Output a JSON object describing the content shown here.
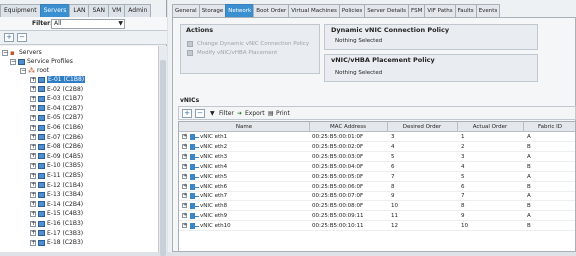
{
  "left_nav": {
    "tabs": [
      "Equipment",
      "Servers",
      "LAN",
      "SAN",
      "VM",
      "Admin"
    ],
    "active_tab": "Servers",
    "filter_label": "Filter:",
    "filter_value": "All",
    "add_icon": "+",
    "remove_icon": "−",
    "tree": {
      "servers": "Servers",
      "service_profiles": "Service Profiles",
      "root": "root",
      "profiles": [
        "E-01 (C1B8)",
        "E-02 (C2B8)",
        "E-03 (C1B7)",
        "E-04 (C2B7)",
        "E-05 (C2B7)",
        "E-06 (C1B6)",
        "E-07 (C2B6)",
        "E-08 (C2B6)",
        "E-09 (C4B5)",
        "E-10 (C3B5)",
        "E-11 (C2B5)",
        "E-12 (C1B4)",
        "E-13 (C3B4)",
        "E-14 (C2B4)",
        "E-15 (C4B3)",
        "E-16 (C1B3)",
        "E-17 (C3B3)",
        "E-18 (C2B3)"
      ],
      "selected_index": 0
    }
  },
  "right": {
    "tabs": [
      "General",
      "Storage",
      "Network",
      "Boot Order",
      "Virtual Machines",
      "Policies",
      "Server Details",
      "FSM",
      "VIF Paths",
      "Faults",
      "Events"
    ],
    "active_tab": "Network",
    "actions": {
      "title": "Actions",
      "links": [
        "Change Dynamic vNIC Connection Policy",
        "Modify vNIC/vHBA Placement"
      ]
    },
    "dynamic_policy": {
      "title": "Dynamic vNIC Connection Policy",
      "value": "Nothing Selected"
    },
    "placement_policy": {
      "title": "vNIC/vHBA Placement Policy",
      "value": "Nothing Selected"
    },
    "vnics_title": "vNICs",
    "toolbar": {
      "filter": "Filter",
      "export": "Export",
      "print": "Print"
    },
    "grid": {
      "columns": [
        "Name",
        "MAC Address",
        "Desired Order",
        "Actual Order",
        "Fabric ID"
      ],
      "rows": [
        [
          "vNIC eth1",
          "00:25:B5:00:01:0F",
          "3",
          "1",
          "A"
        ],
        [
          "vNIC eth2",
          "00:25:B5:00:02:0F",
          "4",
          "2",
          "B"
        ],
        [
          "vNIC eth3",
          "00:25:B5:00:03:0F",
          "5",
          "3",
          "A"
        ],
        [
          "vNIC eth4",
          "00:25:B5:00:04:0F",
          "6",
          "4",
          "B"
        ],
        [
          "vNIC eth5",
          "00:25:B5:00:05:0F",
          "7",
          "5",
          "A"
        ],
        [
          "vNIC eth6",
          "00:25:B5:00:06:0F",
          "8",
          "6",
          "B"
        ],
        [
          "vNIC eth7",
          "00:25:B5:00:07:0F",
          "9",
          "7",
          "A"
        ],
        [
          "vNIC eth8",
          "00:25:B5:00:08:0F",
          "10",
          "8",
          "B"
        ],
        [
          "vNIC eth9",
          "00:25:B5:00:09:11",
          "11",
          "9",
          "A"
        ],
        [
          "vNIC eth10",
          "00:25:B5:00:10:11",
          "12",
          "10",
          "B"
        ]
      ]
    }
  }
}
